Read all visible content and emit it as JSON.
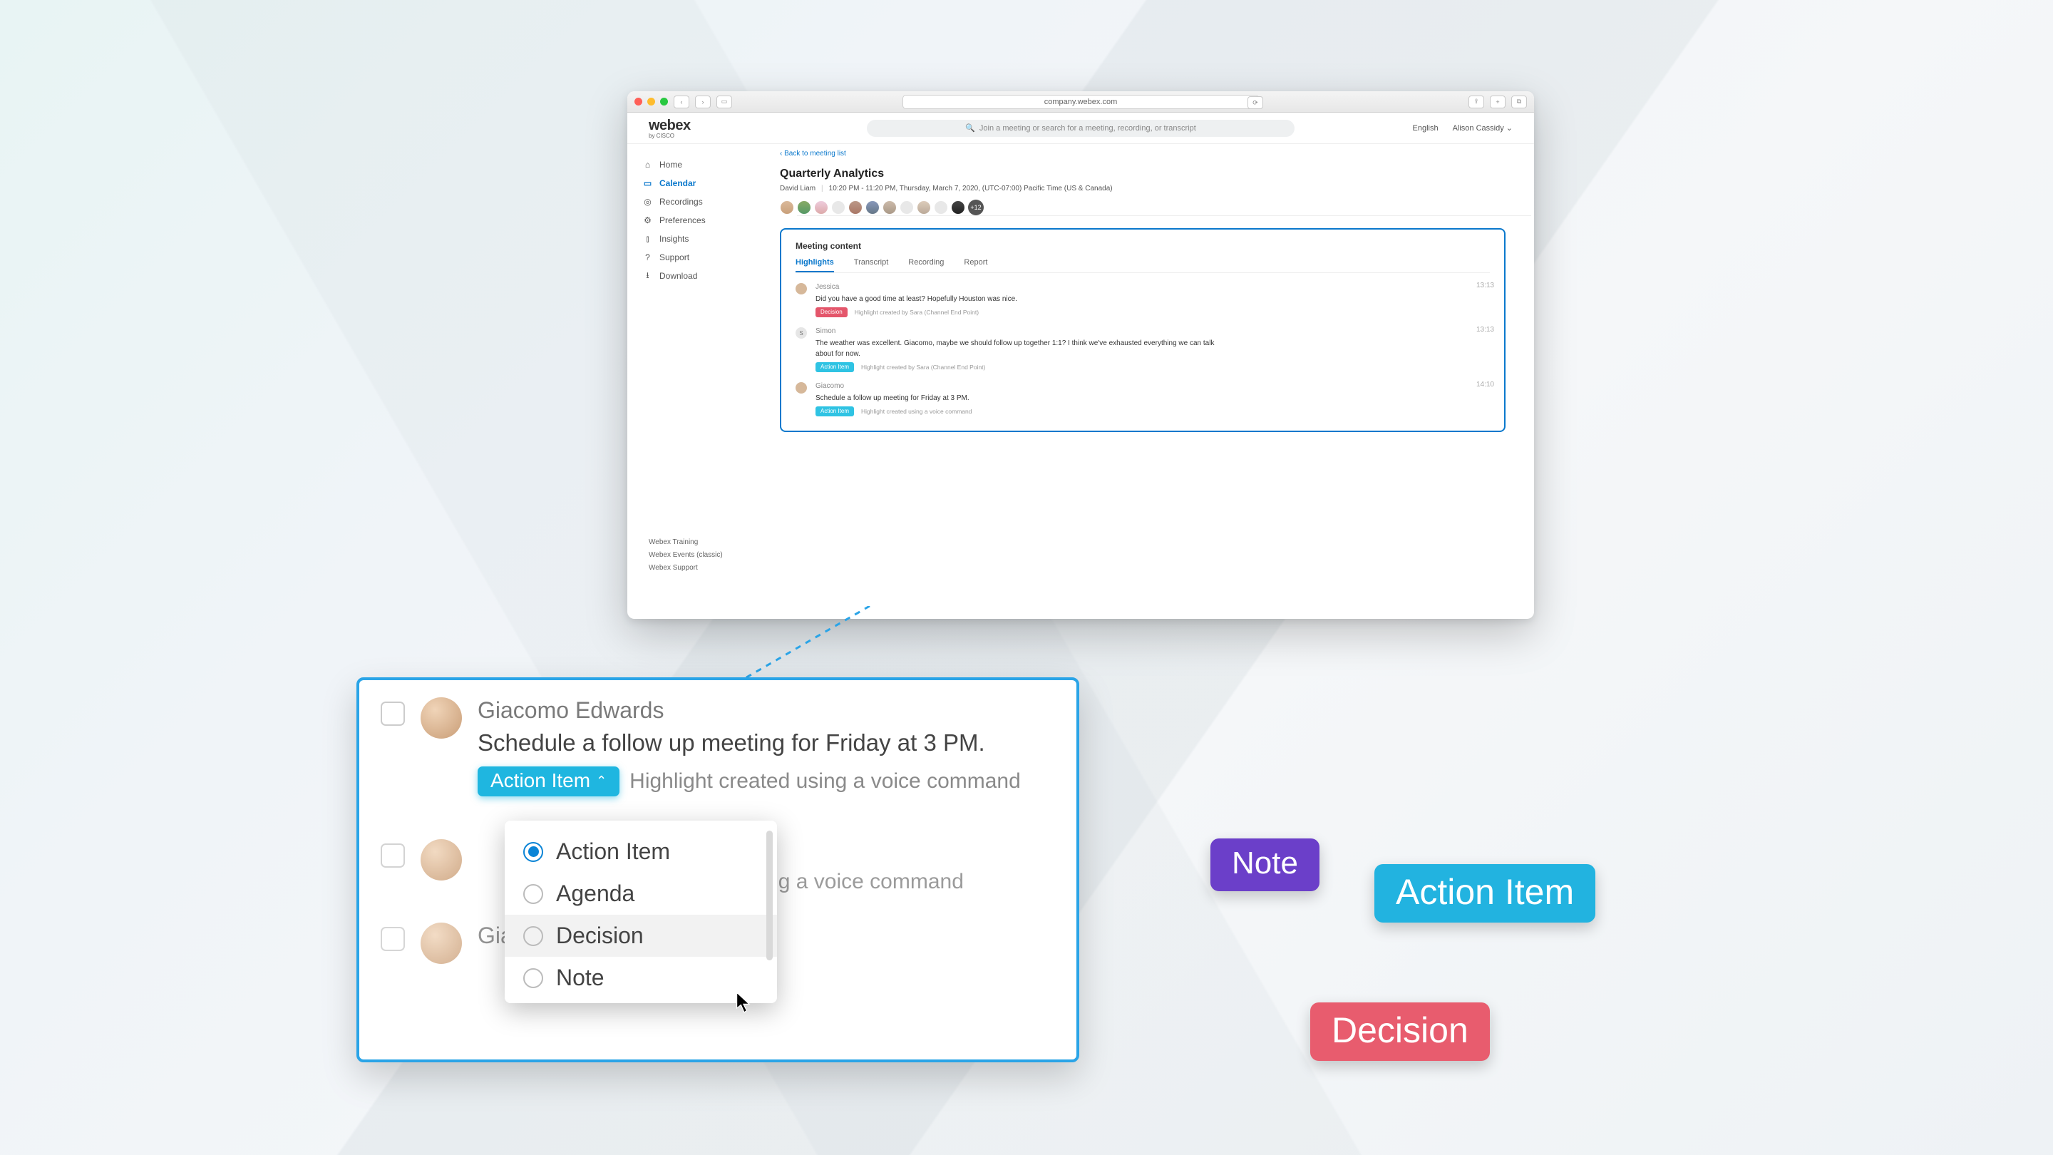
{
  "browser": {
    "url": "company.webex.com"
  },
  "header": {
    "logo": "webex",
    "logo_sub": "by CISCO",
    "search_placeholder": "Join a meeting or search for a meeting, recording, or transcript",
    "language": "English",
    "user": "Alison Cassidy"
  },
  "sidebar": {
    "items": [
      {
        "icon": "⌂",
        "label": "Home"
      },
      {
        "icon": "▭",
        "label": "Calendar",
        "active": true
      },
      {
        "icon": "◎",
        "label": "Recordings"
      },
      {
        "icon": "⚙",
        "label": "Preferences"
      },
      {
        "icon": "⫾",
        "label": "Insights"
      },
      {
        "icon": "?",
        "label": "Support"
      },
      {
        "icon": "⭳",
        "label": "Download"
      }
    ],
    "footer": [
      "Webex Training",
      "Webex Events (classic)",
      "Webex Support"
    ]
  },
  "meeting": {
    "back": "Back to meeting list",
    "title": "Quarterly Analytics",
    "host": "David Liam",
    "time": "10:20 PM - 11:20 PM, Thursday, March 7, 2020, (UTC-07:00) Pacific Time (US & Canada)",
    "attendee_overflow": "+12"
  },
  "content": {
    "panel_title": "Meeting content",
    "tabs": [
      "Highlights",
      "Transcript",
      "Recording",
      "Report"
    ],
    "active_tab": 0,
    "highlights": [
      {
        "name": "Jessica",
        "text": "Did you have a good time at least? Hopefully Houston was nice.",
        "badge": "Decision",
        "badge_type": "decision",
        "via": "Highlight created by Sara (Channel End Point)",
        "time": "13:13"
      },
      {
        "name": "Simon",
        "initial": "S",
        "text": "The weather was excellent. Giacomo, maybe we should follow up together 1:1? I think we've exhausted everything we can talk about for now.",
        "badge": "Action Item",
        "badge_type": "action",
        "via": "Highlight created by Sara (Channel End Point)",
        "time": "13:13"
      },
      {
        "name": "Giacomo",
        "text": "Schedule a follow up meeting for Friday at 3 PM.",
        "badge": "Action Item",
        "badge_type": "action",
        "via": "Highlight created using a voice command",
        "time": "14:10"
      }
    ]
  },
  "popout": {
    "row1": {
      "name": "Giacomo Edwards",
      "msg": "Schedule a follow up meeting for Friday at 3 PM.",
      "badge": "Action Item",
      "via": "Highlight created using a voice command"
    },
    "dropdown": [
      "Action Item",
      "Agenda",
      "Decision",
      "Note"
    ],
    "row2_via": "ated using a voice command",
    "row3_name": "Giacomo Edwards"
  },
  "floating": {
    "note": "Note",
    "action": "Action Item",
    "decision": "Decision"
  }
}
